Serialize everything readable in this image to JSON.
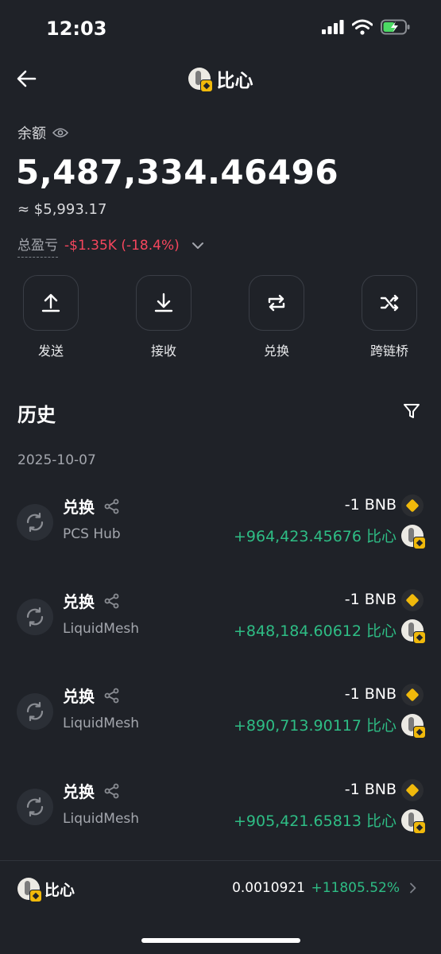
{
  "status_bar": {
    "time": "12:03"
  },
  "header": {
    "title": "比心"
  },
  "balance": {
    "label": "余额",
    "amount": "5,487,334.46496",
    "usd": "≈ $5,993.17",
    "pnl_label": "总盈亏",
    "pnl_value": "-$1.35K (-18.4%)"
  },
  "actions": [
    {
      "label": "发送",
      "icon": "upload-icon"
    },
    {
      "label": "接收",
      "icon": "download-icon"
    },
    {
      "label": "兑换",
      "icon": "swap-icon"
    },
    {
      "label": "跨链桥",
      "icon": "bridge-icon"
    }
  ],
  "history": {
    "title": "历史",
    "date": "2025-10-07",
    "transactions": [
      {
        "type": "兑换",
        "source": "PCS Hub",
        "out": "-1 BNB",
        "in": "+964,423.45676 比心"
      },
      {
        "type": "兑换",
        "source": "LiquidMesh",
        "out": "-1 BNB",
        "in": "+848,184.60612 比心"
      },
      {
        "type": "兑换",
        "source": "LiquidMesh",
        "out": "-1 BNB",
        "in": "+890,713.90117 比心"
      },
      {
        "type": "兑换",
        "source": "LiquidMesh",
        "out": "-1 BNB",
        "in": "+905,421.65813 比心"
      }
    ]
  },
  "bottom_bar": {
    "name": "比心",
    "price": "0.0010921",
    "change": "+11805.52%"
  },
  "colors": {
    "background": "#1f2228",
    "positive": "#2ebd85",
    "negative": "#f6465d",
    "bnb": "#f0b90b"
  }
}
